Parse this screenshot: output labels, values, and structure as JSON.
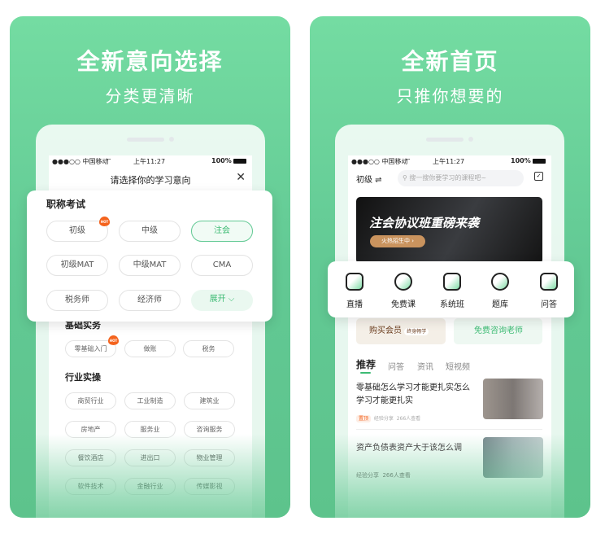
{
  "left": {
    "title": "全新意向选择",
    "subtitle": "分类更清晰",
    "status": {
      "carrier": "●●●○○ 中国移动",
      "wifi": "wifi-icon",
      "time": "上午11:27",
      "battery": "100%"
    },
    "dialog_title": "请选择你的学习意向",
    "section1": {
      "title": "职称考试",
      "chips": [
        "初级",
        "中级",
        "注会",
        "初级MAT",
        "中级MAT",
        "CMA",
        "税务师",
        "经济师",
        "展开"
      ],
      "selected": "注会",
      "hot": "初级",
      "hot_label": "HOT"
    },
    "section2": {
      "title": "基础实务",
      "chips": [
        "零基础入门",
        "做账",
        "税务"
      ],
      "hot": "零基础入门"
    },
    "section3": {
      "title": "行业实操",
      "chips": [
        "商贸行业",
        "工业制造",
        "建筑业",
        "房地产",
        "服务业",
        "咨询服务",
        "餐饮酒店",
        "进出口",
        "物业管理",
        "软件技术",
        "金融行业",
        "传媒影视"
      ]
    }
  },
  "right": {
    "title": "全新首页",
    "subtitle": "只推你想要的",
    "status": {
      "carrier": "●●●○○ 中国移动",
      "time": "上午11:27",
      "battery": "100%"
    },
    "level": "初级 ⇌",
    "search_placeholder": "搜一搜你要学习的课程吧~",
    "banner": {
      "title": "注会协议班重磅来袭",
      "button": "火热招生中 ›"
    },
    "quick": [
      {
        "label": "直播",
        "icon": "tv-icon"
      },
      {
        "label": "免费课",
        "icon": "play-icon"
      },
      {
        "label": "系统班",
        "icon": "box-icon"
      },
      {
        "label": "题库",
        "icon": "compass-icon"
      },
      {
        "label": "问答",
        "icon": "chat-icon"
      }
    ],
    "promo": {
      "member": "购买会员",
      "member_tag": "终身畅学",
      "consult": "免费咨询老师"
    },
    "tabs": [
      "推荐",
      "问答",
      "资讯",
      "短视频"
    ],
    "articles": [
      {
        "title": "零基础怎么学习才能更扎实怎么学习才能更扎实",
        "tag": "置顶",
        "category": "经验分享",
        "views": "266人查看"
      },
      {
        "title": "资产负债表资产大于该怎么调",
        "category": "经验分享",
        "views": "266人查看"
      }
    ]
  },
  "colors": {
    "accent": "#3dbb74",
    "panel": "#62c994",
    "hot": "#f4631d"
  }
}
